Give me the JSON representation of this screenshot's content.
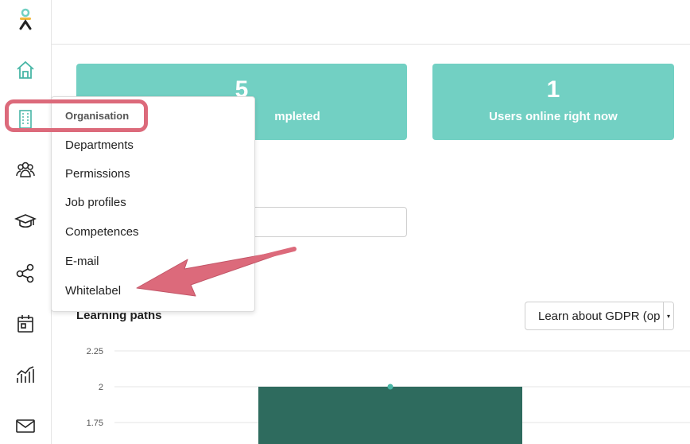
{
  "sidebar": {
    "items": [
      {
        "name": "logo-icon"
      },
      {
        "name": "home-icon"
      },
      {
        "name": "organisation-icon"
      },
      {
        "name": "users-icon"
      },
      {
        "name": "courses-icon"
      },
      {
        "name": "share-icon"
      },
      {
        "name": "calendar-icon"
      },
      {
        "name": "reports-icon"
      },
      {
        "name": "mail-icon"
      }
    ],
    "accent_color": "#72d0c3"
  },
  "stats": [
    {
      "value": "5",
      "label": "mpleted"
    },
    {
      "value": "1",
      "label": "Users online right now"
    }
  ],
  "learning_paths": {
    "title": "Learning paths",
    "select_value": "Learn about GDPR (op"
  },
  "chart_data": {
    "type": "bar",
    "categories": [
      ""
    ],
    "values": [
      2
    ],
    "yticks": [
      "2.25",
      "2",
      "1.75"
    ],
    "ylim": [
      1.7,
      2.3
    ],
    "bar_color": "#2e6b5e",
    "grid": true
  },
  "menu": {
    "header": "Organisation",
    "items": [
      "Departments",
      "Permissions",
      "Job profiles",
      "Competences",
      "E-mail",
      "Whitelabel"
    ]
  },
  "annotation": {
    "color": "#dc6a7b"
  }
}
